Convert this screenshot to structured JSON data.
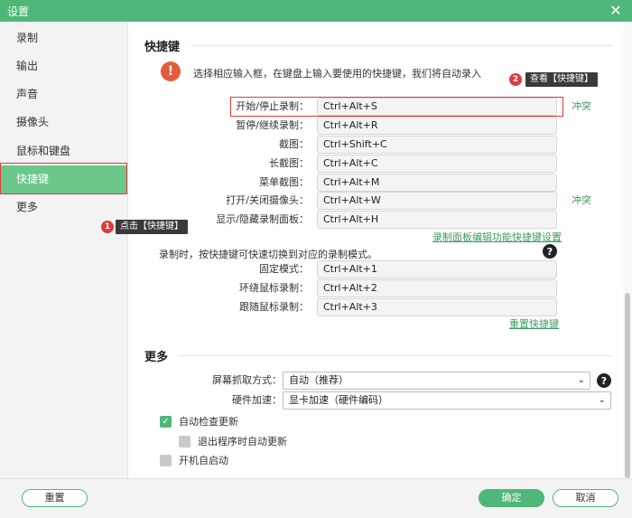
{
  "window": {
    "title": "设置"
  },
  "sidebar": {
    "items": [
      {
        "label": "录制",
        "active": false
      },
      {
        "label": "输出",
        "active": false
      },
      {
        "label": "声音",
        "active": false
      },
      {
        "label": "摄像头",
        "active": false
      },
      {
        "label": "鼠标和键盘",
        "active": false
      },
      {
        "label": "快捷键",
        "active": true
      },
      {
        "label": "更多",
        "active": false
      }
    ]
  },
  "hotkeys": {
    "section_title": "快捷键",
    "tip": "选择相应输入框，在键盘上输入要使用的快捷键，我们将自动录入",
    "conflict_label": "冲突",
    "rows": [
      {
        "label": "开始/停止录制：",
        "value": "Ctrl+Alt+S"
      },
      {
        "label": "暂停/继续录制：",
        "value": "Ctrl+Alt+R"
      },
      {
        "label": "截图：",
        "value": "Ctrl+Shift+C"
      },
      {
        "label": "长截图：",
        "value": "Ctrl+Alt+C"
      },
      {
        "label": "菜单截图：",
        "value": "Ctrl+Alt+M"
      },
      {
        "label": "打开/关闭摄像头：",
        "value": "Ctrl+Alt+W"
      },
      {
        "label": "显示/隐藏录制面板：",
        "value": "Ctrl+Alt+H"
      }
    ],
    "panel_link": "录制面板编辑功能快捷键设置",
    "mode_tip": "录制时，按快捷键可快速切换到对应的录制模式。",
    "mode_rows": [
      {
        "label": "固定模式：",
        "value": "Ctrl+Alt+1"
      },
      {
        "label": "环绕鼠标录制：",
        "value": "Ctrl+Alt+2"
      },
      {
        "label": "跟随鼠标录制：",
        "value": "Ctrl+Alt+3"
      }
    ],
    "reset_link": "重置快捷键"
  },
  "more": {
    "section_title": "更多",
    "capture_label": "屏幕抓取方式：",
    "capture_value": "自动（推荐）",
    "accel_label": "硬件加速：",
    "accel_value": "显卡加速（硬件编码）",
    "auto_update": "自动检查更新",
    "exit_update": "退出程序时自动更新",
    "autostart": "开机自启动"
  },
  "footer": {
    "reset": "重置",
    "ok": "确定",
    "cancel": "取消"
  },
  "annotations": {
    "step1_num": "1",
    "step1_text": "点击【快捷键】",
    "step2_num": "2",
    "step2_text": "查看【快捷键】"
  },
  "colors": {
    "accent": "#4fb878",
    "warn": "#e35b3a",
    "annotation": "#e03a3a"
  }
}
